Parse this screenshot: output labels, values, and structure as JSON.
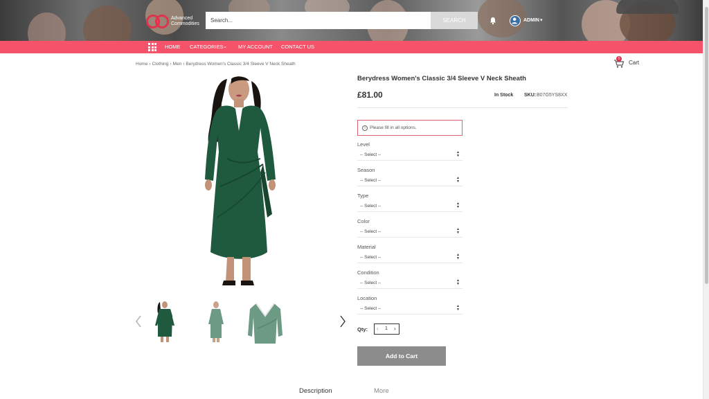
{
  "header": {
    "logo_line1": "Advanced",
    "logo_line2": "Commodities",
    "search_placeholder": "Search...",
    "search_button": "SEARCH",
    "user_name": "ADMIN",
    "bell_icon": "bell-icon",
    "user_icon": "user-avatar-icon"
  },
  "nav": {
    "menu_icon": "grid-menu-icon",
    "items": [
      {
        "label": "HOME"
      },
      {
        "label": "CATEGORIES"
      },
      {
        "label": "MY ACCOUNT"
      },
      {
        "label": "CONTACT US"
      }
    ]
  },
  "cart": {
    "label": "Cart",
    "count": "0",
    "icon": "cart-icon"
  },
  "breadcrumb": [
    "Home",
    "Clothing",
    "Men",
    "Berydress Women's Classic 3/4 Sleeve V Neck Sheath"
  ],
  "product": {
    "title": "Berydress Women's Classic 3/4 Sleeve V Neck Sheath",
    "price": "£81.00",
    "stock": "In Stock",
    "sku_label": "SKU:",
    "sku_value": "B07G5YS8XX",
    "dress_color": "#1f5a3e",
    "thumb_alt_color": "#6c9a84"
  },
  "alert": {
    "text": "Please fill in all options.",
    "icon": "info-circle-icon"
  },
  "options": [
    {
      "label": "Level",
      "value": "-- Select --"
    },
    {
      "label": "Season",
      "value": "-- Select --"
    },
    {
      "label": "Type",
      "value": "-- Select --"
    },
    {
      "label": "Color",
      "value": "-- Select --"
    },
    {
      "label": "Material",
      "value": "-- Select --"
    },
    {
      "label": "Condition",
      "value": "-- Select --"
    },
    {
      "label": "Location",
      "value": "-- Select --"
    }
  ],
  "quantity": {
    "label": "Qty:",
    "value": "1"
  },
  "add_to_cart": "Add to Cart",
  "tabs": [
    {
      "label": "Description",
      "active": true
    },
    {
      "label": "More",
      "active": false
    }
  ],
  "colors": {
    "accent": "#f4536a",
    "button_gray": "#8c8c8c",
    "alert_border": "#e06070"
  }
}
